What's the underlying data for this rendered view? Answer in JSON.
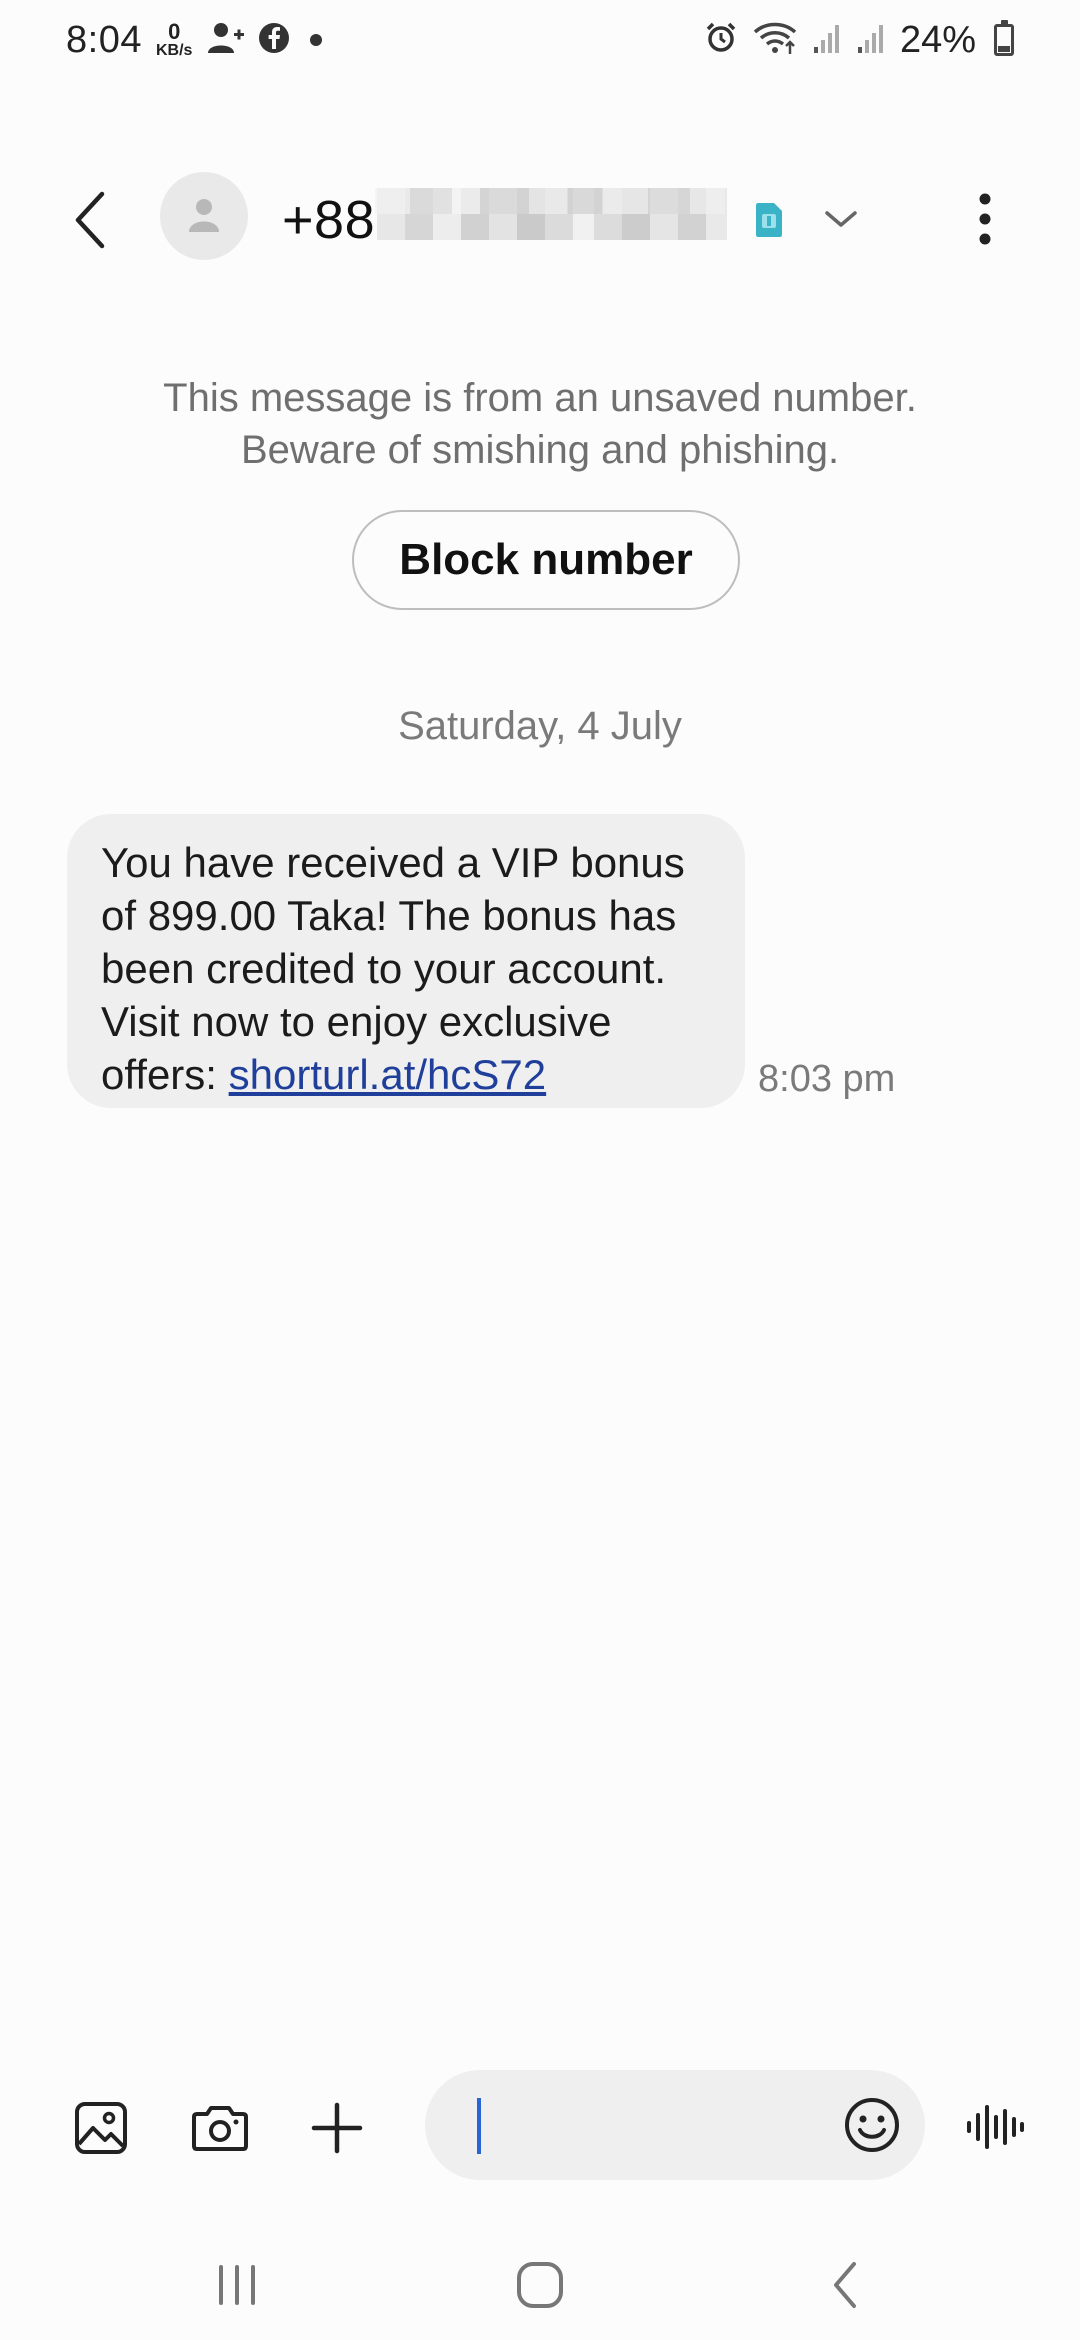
{
  "status_bar": {
    "time": "8:04",
    "net_speed_value": "0",
    "net_speed_unit": "KB/s",
    "battery_percent": "24%",
    "icons": [
      "person-add-icon",
      "facebook-icon",
      "dot-icon",
      "alarm-icon",
      "wifi-icon",
      "signal-icon",
      "signal-icon",
      "battery-icon"
    ]
  },
  "header": {
    "contact_number_visible": "+88",
    "icons": [
      "back-icon",
      "avatar-icon",
      "sim-icon",
      "chevron-down-icon",
      "more-vert-icon"
    ]
  },
  "warning": {
    "line1": "This message is from an unsaved number.",
    "line2": "Beware of smishing and phishing.",
    "block_button_label": "Block number"
  },
  "conversation": {
    "date": "Saturday, 4 July",
    "messages": [
      {
        "text": "You have received a VIP bonus of 899.00 Taka! The bonus has been credited to your account. Visit now to enjoy exclusive offers: ",
        "link": "shorturl.at/hcS72",
        "time": "8:03 pm"
      }
    ]
  },
  "composer": {
    "input_value": "",
    "icons": [
      "gallery-icon",
      "camera-icon",
      "plus-icon",
      "emoji-icon",
      "voice-icon"
    ]
  },
  "navbar": {
    "icons": [
      "recent-apps-icon",
      "home-icon",
      "back-nav-icon"
    ]
  },
  "colors": {
    "background": "#fcfcfc",
    "bubble": "#efefef",
    "link": "#1f3f9a",
    "caret": "#2b63d9",
    "sim_badge": "#3bb3c6"
  }
}
